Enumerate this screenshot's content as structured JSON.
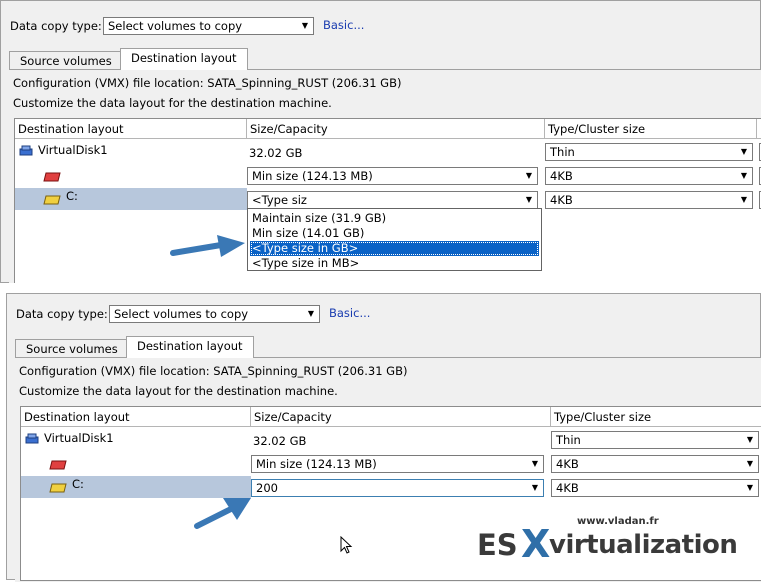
{
  "top": {
    "copy_type_label": "Data copy type:",
    "copy_type_value": "Select volumes to copy",
    "basic_link": "Basic...",
    "tabs": [
      "Source volumes",
      "Destination layout"
    ],
    "vmx_location": "Configuration (VMX) file location: SATA_Spinning_RUST (206.31 GB)",
    "customize_text": "Customize the data layout for the destination machine.",
    "columns": [
      "Destination layout",
      "Size/Capacity",
      "Type/Cluster size"
    ],
    "rows": [
      {
        "name": "VirtualDisk1",
        "size": "32.02 GB",
        "type": "Thin"
      },
      {
        "name": "",
        "size": "Min size (124.13 MB)",
        "type": "4KB"
      },
      {
        "name": "C:",
        "size": "<Type siz",
        "type": "4KB"
      }
    ],
    "dropdown_options": [
      "Maintain size (31.9 GB)",
      "Min size (14.01 GB)",
      "<Type size in GB>",
      "<Type size in MB>"
    ],
    "dropdown_selected": "<Type size in GB>"
  },
  "bottom": {
    "copy_type_label": "Data copy type:",
    "copy_type_value": "Select volumes to copy",
    "basic_link": "Basic...",
    "tabs": [
      "Source volumes",
      "Destination layout"
    ],
    "vmx_location": "Configuration (VMX) file location: SATA_Spinning_RUST (206.31 GB)",
    "customize_text": "Customize the data layout for the destination machine.",
    "columns": [
      "Destination layout",
      "Size/Capacity",
      "Type/Cluster size"
    ],
    "rows": [
      {
        "name": "VirtualDisk1",
        "size": "32.02 GB",
        "type": "Thin"
      },
      {
        "name": "",
        "size": "Min size (124.13 MB)",
        "type": "4KB"
      },
      {
        "name": "C:",
        "size": "200",
        "type": "4KB"
      }
    ]
  },
  "watermark": {
    "site": "www.vladan.fr",
    "brand_es": "ES",
    "brand_x": "X",
    "brand_rest": "virtualization"
  },
  "colors": {
    "arrow": "#3a78b5",
    "selection": "#0a62c6",
    "selected_row": "#b7c7dc",
    "link": "#1a3cb0"
  }
}
